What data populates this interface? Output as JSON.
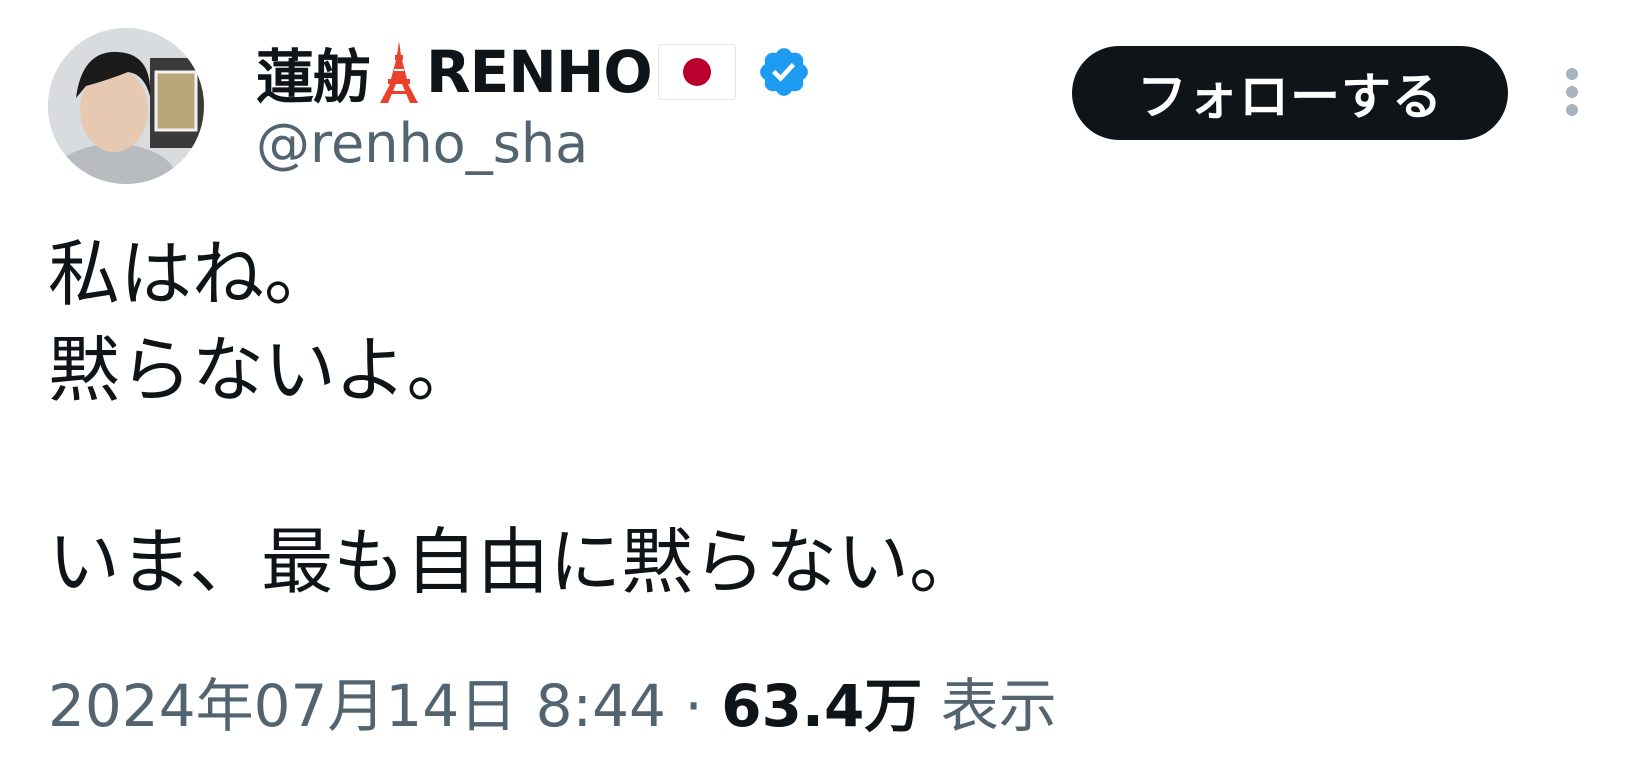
{
  "author": {
    "display_name": "蓮舫",
    "display_name_suffix": "RENHO",
    "handle": "@renho_sha",
    "icons": [
      "tokyo-tower-icon",
      "japan-flag-icon",
      "verified-badge-icon"
    ],
    "verified_color": "#1d9bf0"
  },
  "actions": {
    "follow_label": "フォローする",
    "more_icon": "more-vertical-icon"
  },
  "tweet": {
    "lines": [
      "私はね。",
      "黙らないよ。",
      "",
      "いま、最も自由に黙らない。"
    ]
  },
  "meta": {
    "timestamp": "2024年07月14日 8:44",
    "separator": " · ",
    "views_count": "63.4万",
    "views_label": " 表示"
  },
  "colors": {
    "text_primary": "#0f1419",
    "text_secondary": "#536471",
    "button_bg": "#0f1419",
    "button_text": "#ffffff"
  }
}
